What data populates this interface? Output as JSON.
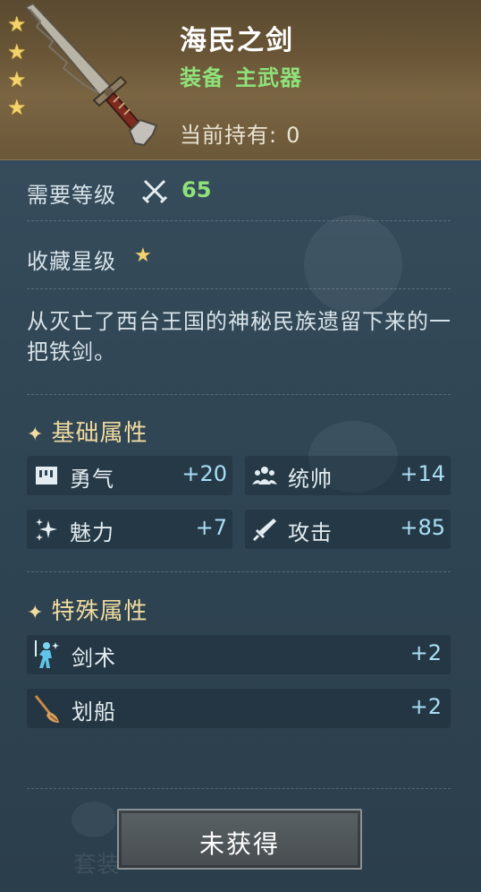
{
  "item": {
    "name": "海民之剑",
    "category": "装备",
    "slot": "主武器",
    "hold_label": "当前持有:",
    "hold_count": "0",
    "rarity_stars": 4
  },
  "requirements": {
    "level_label": "需要等级",
    "level_value": "65",
    "collect_label": "收藏星级",
    "collect_stars": 1
  },
  "description": "从灭亡了西台王国的神秘民族遗留下来的一把铁剑。",
  "base_attributes": {
    "title": "基础属性",
    "items": [
      {
        "name": "勇气",
        "value": "+20",
        "icon": "courage-icon"
      },
      {
        "name": "统帅",
        "value": "+14",
        "icon": "command-icon"
      },
      {
        "name": "魅力",
        "value": "+7",
        "icon": "charm-icon"
      },
      {
        "name": "攻击",
        "value": "+85",
        "icon": "attack-sword-icon"
      }
    ]
  },
  "special_attributes": {
    "title": "特殊属性",
    "items": [
      {
        "name": "剑术",
        "value": "+2",
        "icon": "swordsmanship-icon"
      },
      {
        "name": "划船",
        "value": "+2",
        "icon": "rowing-icon"
      }
    ]
  },
  "action_button": "未获得",
  "background_label": "套装",
  "colors": {
    "header_gold": "#6a5637",
    "accent_green": "#8fe27a",
    "value_blue": "#a9dff6",
    "section_gold": "#f1dba0",
    "star_gold": "#f3d36b"
  }
}
